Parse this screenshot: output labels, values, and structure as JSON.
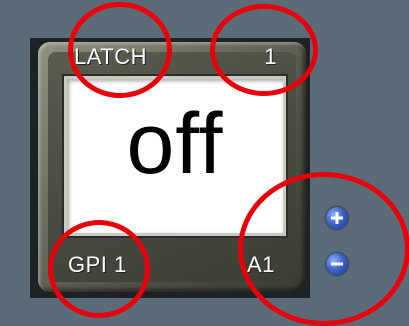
{
  "gpi_panel": {
    "mode_label": "LATCH",
    "channel_number": "1",
    "state_value": "off",
    "gpi_label": "GPI 1",
    "address_label": "A1"
  },
  "controls": {
    "increment_icon": "plus-icon",
    "decrement_icon": "minus-icon"
  },
  "annotations": {
    "circle_color": "#e8000a"
  }
}
